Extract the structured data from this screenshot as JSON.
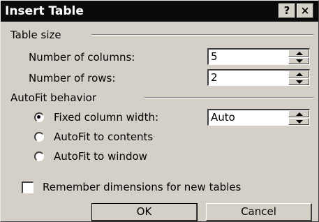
{
  "window": {
    "title": "Insert Table",
    "help_label": "?",
    "close_label": "×"
  },
  "table_size": {
    "label": "Table size",
    "columns_label": "Number of columns:",
    "columns_value": "5",
    "rows_label": "Number of rows:",
    "rows_value": "2"
  },
  "autofit": {
    "label": "AutoFit behavior",
    "fixed_width_label": "Fixed column width:",
    "fixed_width_value": "Auto",
    "fixed_width_selected": true,
    "contents_label": "AutoFit to contents",
    "window_label": "AutoFit to window"
  },
  "remember": {
    "label": "Remember dimensions for new tables",
    "checked": false
  },
  "buttons": {
    "ok_label": "OK",
    "cancel_label": "Cancel"
  }
}
